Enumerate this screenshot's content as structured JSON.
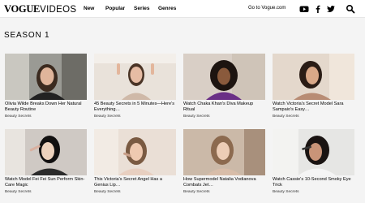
{
  "header": {
    "logo_vogue": "VOGUE",
    "logo_videos": "VIDEOS",
    "nav": [
      "New",
      "Popular",
      "Series",
      "Genres"
    ],
    "goto_link": "Go to Vogue.com",
    "social_icons": [
      "youtube-icon",
      "facebook-icon",
      "twitter-icon",
      "search-icon"
    ]
  },
  "season_title": "SEASON 1",
  "videos": [
    {
      "title": "Olivia Wilde Breaks Down Her Natural Beauty Routine",
      "category": "Beauty Secrets"
    },
    {
      "title": "45 Beauty Secrets in 5 Minutes—Here's Everything…",
      "category": "Beauty Secrets"
    },
    {
      "title": "Watch Chaka Khan's Diva Makeup Ritual",
      "category": "Beauty Secrets"
    },
    {
      "title": "Watch Victoria's Secret Model Sara Sampaio's Easy…",
      "category": "Beauty Secrets"
    },
    {
      "title": "Watch Model Fei Fei Sun Perform Skin-Care Magic",
      "category": "Beauty Secrets"
    },
    {
      "title": "This Victoria's Secret Angel Has a Genius Lip…",
      "category": "Beauty Secrets"
    },
    {
      "title": "How Supermodel Natalia Vodianova Combats Jet…",
      "category": "Beauty Secrets"
    },
    {
      "title": "Watch Cassie's 10-Second Smoky Eye Trick",
      "category": "Beauty Secrets"
    }
  ],
  "colors": {
    "header_bg": "#ffffff",
    "page_bg": "#f4f4f4",
    "text": "#000000"
  }
}
